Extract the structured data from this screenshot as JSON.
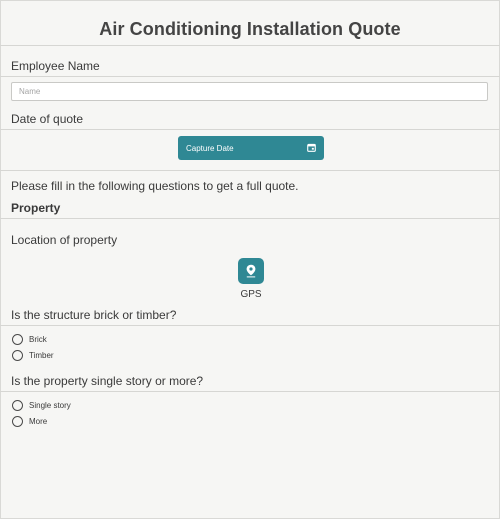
{
  "form": {
    "title": "Air Conditioning Installation Quote",
    "employee": {
      "label": "Employee Name",
      "placeholder": "Name",
      "value": ""
    },
    "date": {
      "label": "Date of quote",
      "button_label": "Capture Date",
      "icon": "calendar-icon"
    },
    "instructions": "Please fill in the following questions to get a full quote.",
    "property": {
      "heading": "Property",
      "location_label": "Location of property",
      "gps_icon": "map-pin-icon",
      "gps_label": "GPS"
    },
    "structure": {
      "question": "Is the structure brick or timber?",
      "options": [
        "Brick",
        "Timber"
      ],
      "selected": null
    },
    "story": {
      "question": "Is the property single story or more?",
      "options": [
        "Single story",
        "More"
      ],
      "selected": null
    },
    "colors": {
      "accent": "#2f8894",
      "background": "#f6f6f4"
    }
  }
}
